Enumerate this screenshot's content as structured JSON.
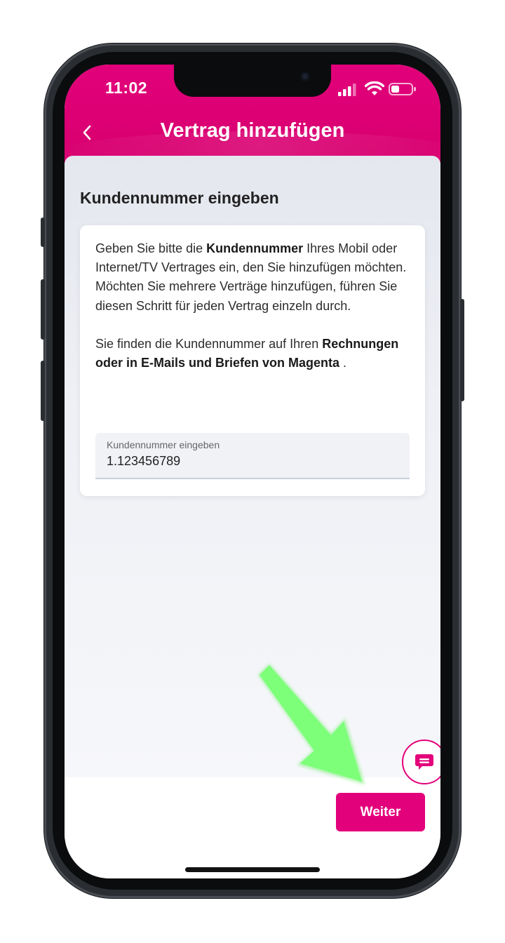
{
  "status_bar": {
    "time": "11:02",
    "icons": [
      "cellular-signal-icon",
      "wifi-icon",
      "battery-icon"
    ]
  },
  "header": {
    "title": "Vertrag hinzufügen",
    "back_icon": "chevron-left-icon"
  },
  "main": {
    "section_title": "Kundennummer eingeben",
    "card": {
      "p1_prefix": "Geben Sie bitte die ",
      "p1_bold": "Kundennummer",
      "p1_suffix": " Ihres Mobil oder Internet/TV Vertrages ein, den Sie hinzufügen möchten.",
      "p2": "Möchten Sie mehrere Verträge hinzufügen, führen Sie diesen Schritt für jeden Vertrag einzeln durch.",
      "p3_prefix": "Sie finden die Kundennummer auf Ihren ",
      "p3_bold": "Rechnungen oder in E-Mails und Briefen von Magenta",
      "p3_suffix": " ."
    },
    "input": {
      "label": "Kundennummer eingeben",
      "value": "1.123456789"
    }
  },
  "footer": {
    "next_label": "Weiter"
  },
  "chat": {
    "icon": "chat-bubble-icon"
  },
  "colors": {
    "brand": "#e20074",
    "annotation_arrow": "#7dff7a"
  }
}
